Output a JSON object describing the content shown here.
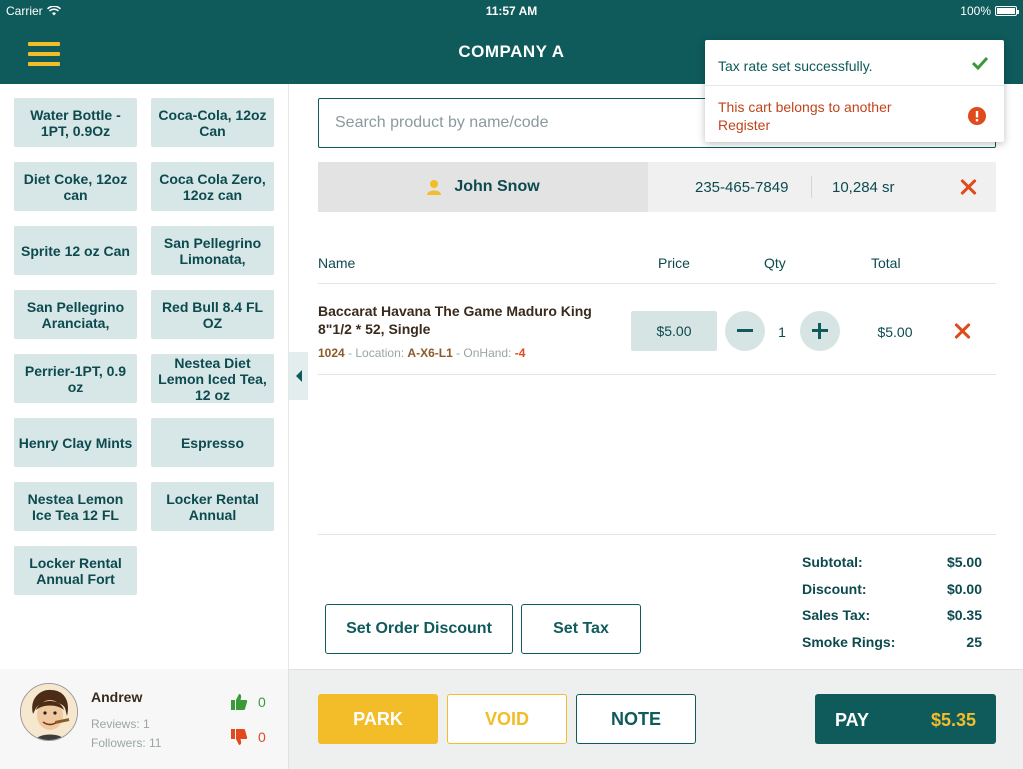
{
  "status_bar": {
    "carrier": "Carrier",
    "time": "11:57 AM",
    "battery": "100%"
  },
  "header": {
    "title": "COMPANY A",
    "menu_icon": "hamburger-menu-icon"
  },
  "products": [
    "Water Bottle - 1PT, 0.9Oz",
    "Coca-Cola, 12oz Can",
    "Diet Coke, 12oz can",
    "Coca Cola Zero, 12oz can",
    "Sprite 12 oz Can",
    "San Pellegrino Limonata,",
    "San Pellegrino Aranciata,",
    "Red Bull 8.4 FL OZ",
    "Perrier-1PT, 0.9 oz",
    "Nestea Diet Lemon Iced Tea, 12 oz",
    "Henry Clay Mints",
    "Espresso",
    "Nestea Lemon Ice Tea 12 FL",
    "Locker Rental Annual",
    "Locker Rental Annual Fort"
  ],
  "search": {
    "placeholder": "Search product by name/code"
  },
  "customer": {
    "name": "John Snow",
    "phone": "235-465-7849",
    "points": "10,284 sr"
  },
  "cart": {
    "columns": {
      "name": "Name",
      "price": "Price",
      "qty": "Qty",
      "total": "Total"
    },
    "items": [
      {
        "name": "Baccarat Havana The Game Maduro King 8\"1/2 * 52, Single",
        "code": "1024",
        "location_label": " - Location: ",
        "location": "A-X6-L1",
        "onhand_label": " - OnHand: ",
        "onhand": "-4",
        "price": "$5.00",
        "qty": "1",
        "total": "$5.00"
      }
    ]
  },
  "buttons": {
    "set_order_discount": "Set Order Discount",
    "set_tax": "Set Tax"
  },
  "summary": {
    "subtotal_label": "Subtotal:",
    "subtotal": "$5.00",
    "discount_label": "Discount:",
    "discount": "$0.00",
    "sales_tax_label": "Sales Tax:",
    "sales_tax": "$0.35",
    "smoke_rings_label": "Smoke Rings:",
    "smoke_rings": "25"
  },
  "user": {
    "name": "Andrew",
    "reviews": "Reviews: 1",
    "followers": "Followers: 11",
    "likes": "0",
    "dislikes": "0"
  },
  "actions": {
    "park": "PARK",
    "void": "VOID",
    "note": "NOTE",
    "pay": "PAY",
    "pay_amount": "$5.35"
  },
  "notifications": [
    {
      "message": "Tax rate set successfully.",
      "type": "success"
    },
    {
      "message": "This cart belongs to another Register",
      "type": "error"
    }
  ],
  "colors": {
    "primary": "#0f5a5b",
    "accent": "#f2bd28",
    "danger": "#e04a1c",
    "tile": "#d7e6e6",
    "success": "#3a9a3a"
  }
}
